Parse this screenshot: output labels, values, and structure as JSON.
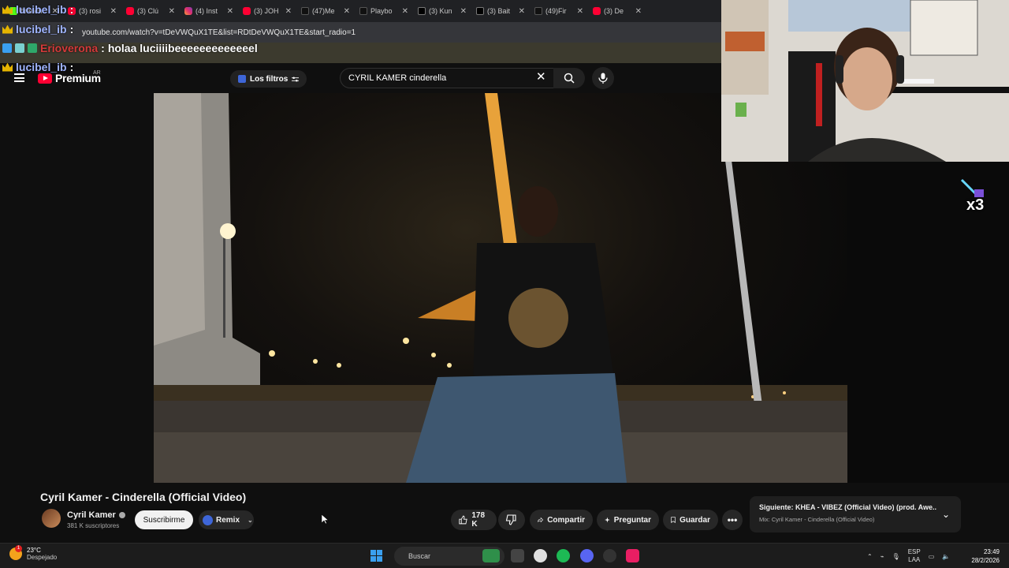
{
  "browser": {
    "tabs": [
      {
        "title": "ffranch",
        "favicon": "kick-icon"
      },
      {
        "title": "(3) rosi",
        "favicon": "youtube-icon"
      },
      {
        "title": "(3) Clú",
        "favicon": "youtube-icon"
      },
      {
        "title": "(4) Inst",
        "favicon": "instagram-icon"
      },
      {
        "title": "(3) JOH",
        "favicon": "youtube-icon"
      },
      {
        "title": "(47)Me",
        "favicon": "tiktok-icon"
      },
      {
        "title": "Playbo",
        "favicon": "tiktok-icon"
      },
      {
        "title": "(3) Kun",
        "favicon": "x-icon"
      },
      {
        "title": "(3) Bait",
        "favicon": "x-icon"
      },
      {
        "title": "(49)Fir",
        "favicon": "tiktok-icon"
      },
      {
        "title": "(3) De",
        "favicon": "youtube-icon"
      }
    ],
    "url": "youtube.com/watch?v=tDeVWQuX1TE&list=RDtDeVWQuX1TE&start_radio=1"
  },
  "chat": [
    {
      "user": "lucibel_ib",
      "sep": ":",
      "message": ""
    },
    {
      "user": "lucibel_ib",
      "sep": ":",
      "message": ""
    },
    {
      "user": "Erioverona",
      "sep": ":",
      "message": "holaa luciiiibeeeeeeeeeeeeel"
    },
    {
      "user": "lucibel_ib",
      "sep": ":",
      "message": ""
    }
  ],
  "youtube": {
    "logo_text": "Premium",
    "country": "AR",
    "filters_label": "Los filtros",
    "search_value": "CYRIL KAMER cinderella",
    "video_title": "Cyril Kamer - Cinderella (Official Video)",
    "channel_name": "Cyril Kamer",
    "subscribers": "381 K suscriptores",
    "subscribe_label": "Suscribirme",
    "remix_label": "Remix",
    "likes": "178 K",
    "share_label": "Compartir",
    "ask_label": "Preguntar",
    "save_label": "Guardar",
    "next_title": "Siguiente: KHEA - VIBEZ (Official Video) (prod. Awe...",
    "next_sub": "Mix: Cyril Kamer - Cinderella (Official Video)"
  },
  "overlay": {
    "multiplier": "x3"
  },
  "taskbar": {
    "temp": "23°C",
    "weather": "Despejado",
    "weather_badge": "1",
    "search_placeholder": "Buscar",
    "lang1": "ESP",
    "lang2": "LAA",
    "time": "23:49",
    "date": "28/2/2026"
  },
  "colors": {
    "yt_red": "#ff0033",
    "accent_blue": "#3e66d8",
    "chat_name": "#9fb4ff",
    "chat_name_alt": "#d43a3a"
  }
}
